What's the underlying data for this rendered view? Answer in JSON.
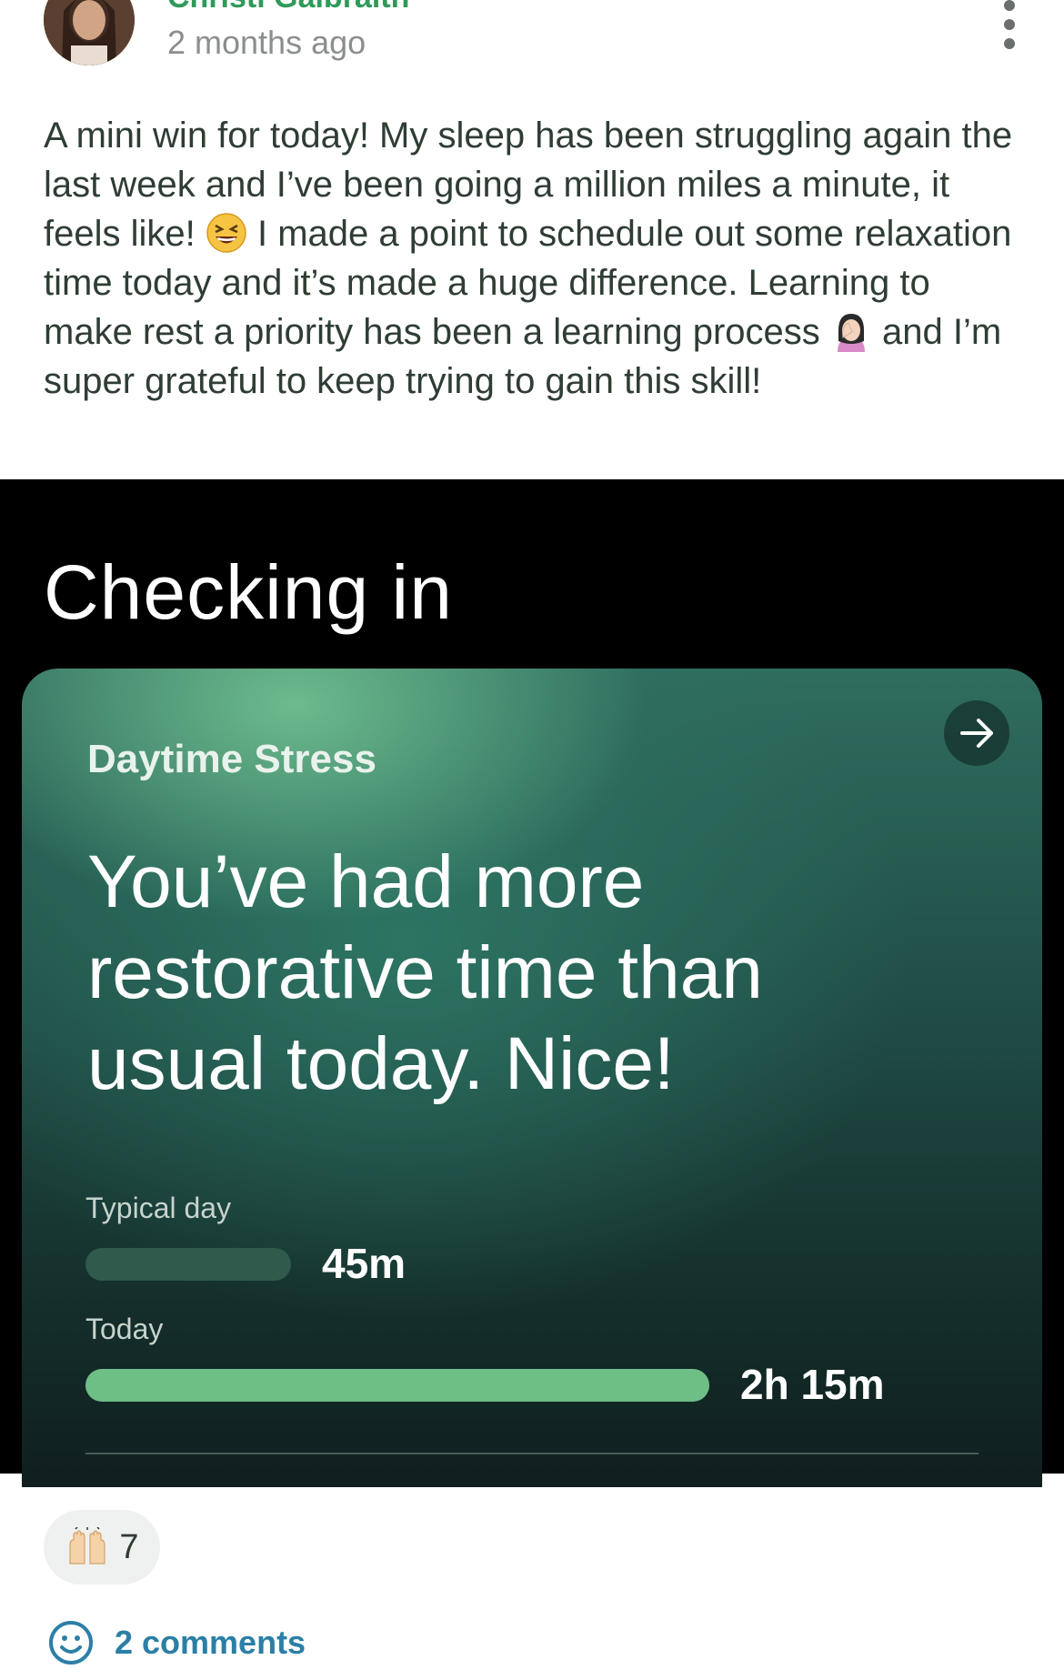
{
  "post": {
    "author": "Christi Galbraith",
    "time": "2 months ago",
    "text_parts": [
      "A mini win for today! My sleep has been struggling again the last week and I’ve been going a million miles a minute, it feels like!",
      " I made a point to schedule out some relaxation time today and it’s made a huge difference. Learning to make rest a priority has been a learning process ",
      " and I’m super grateful to keep trying to gain this skill!"
    ],
    "emojis": [
      "grinning-squinting-face-icon",
      "face-palm-icon"
    ]
  },
  "shared_image": {
    "title": "Checking in",
    "card": {
      "label": "Daytime Stress",
      "headline": "You’ve had more restorative time than usual today. Nice!",
      "rows": [
        {
          "label": "Typical day",
          "value": "45m",
          "fraction": 0.33,
          "color": "#2f5a4c"
        },
        {
          "label": "Today",
          "value": "2h 15m",
          "fraction": 1.0,
          "color": "#6dbf86"
        }
      ]
    }
  },
  "footer": {
    "reaction_icon": "raising-hands-icon",
    "reaction_count": "7",
    "comments_label": "2 comments",
    "comments_icon": "smiley-face-icon",
    "accent_color": "#2b7fa6"
  }
}
